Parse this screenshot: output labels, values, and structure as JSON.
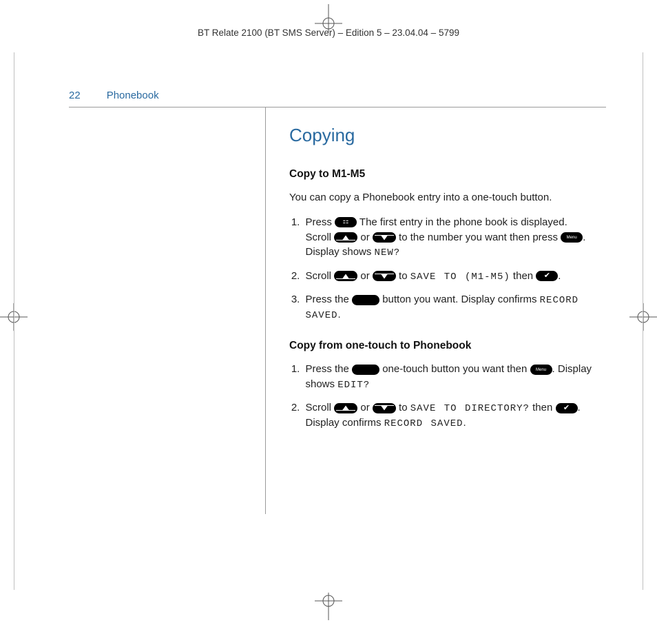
{
  "doc": {
    "header": "BT Relate 2100 (BT SMS Server) – Edition 5 – 23.04.04 – 5799",
    "page_number": "22",
    "section": "Phonebook"
  },
  "content": {
    "title": "Copying",
    "sub1": "Copy to M1-M5",
    "intro1": "You can copy a Phonebook entry into a one-touch button.",
    "s1_1a": "Press ",
    "s1_1b": " The first entry in the phone book is displayed. Scroll ",
    "s1_1c": " or ",
    "s1_1d": " to the number you want then press ",
    "s1_1e": ". Display shows ",
    "s1_1f": "NEW?",
    "s1_2a": "Scroll ",
    "s1_2b": " or ",
    "s1_2c": " to ",
    "s1_2d": "SAVE TO (M1-M5)",
    "s1_2e": " then ",
    "s1_2f": ".",
    "s1_3a": "Press the ",
    "s1_3b": " button you want. Display confirms ",
    "s1_3c": "RECORD SAVED",
    "s1_3d": ".",
    "sub2": "Copy from one-touch to Phonebook",
    "s2_1a": "Press the ",
    "s2_1b": " one-touch button you want then ",
    "s2_1c": ". Display shows ",
    "s2_1d": "EDIT?",
    "s2_2a": "Scroll ",
    "s2_2b": " or ",
    "s2_2c": " to ",
    "s2_2d": "SAVE TO DIRECTORY?",
    "s2_2e": " then ",
    "s2_2f": ". Display confirms ",
    "s2_2g": "RECORD SAVED",
    "s2_2h": "."
  }
}
